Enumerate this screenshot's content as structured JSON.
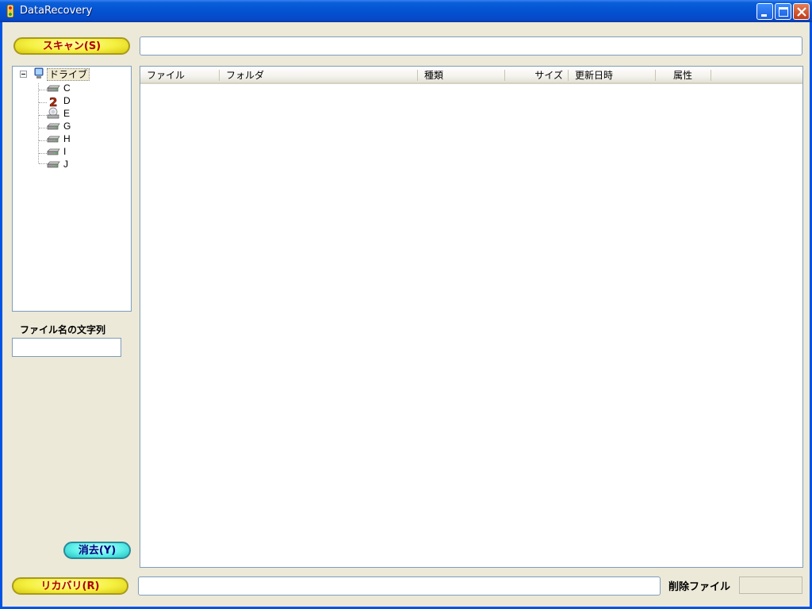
{
  "window": {
    "title": "DataRecovery",
    "accent": "#0054e3",
    "face_color": "#ece9d8"
  },
  "toolbar": {
    "scan_label": "スキャン(S)",
    "scan_path_value": ""
  },
  "tree": {
    "root_label": "ドライブ",
    "root_icon": "computer-icon",
    "drives": [
      {
        "label": "C",
        "icon": "hard-drive-icon"
      },
      {
        "label": "D",
        "icon": "numbered-drive-icon"
      },
      {
        "label": "E",
        "icon": "cd-drive-icon"
      },
      {
        "label": "G",
        "icon": "hard-drive-icon"
      },
      {
        "label": "H",
        "icon": "hard-drive-icon"
      },
      {
        "label": "I",
        "icon": "hard-drive-icon"
      },
      {
        "label": "J",
        "icon": "hard-drive-icon"
      }
    ]
  },
  "filter": {
    "label": "ファイル名の文字列",
    "value": ""
  },
  "clear_button": {
    "label": "消去(Y)"
  },
  "file_list": {
    "columns": [
      "ファイル",
      "フォルダ",
      "種類",
      "サイズ",
      "更新日時",
      "属性"
    ],
    "rows": []
  },
  "footer": {
    "recover_label": "リカバリ(R)",
    "output_path_value": "",
    "deleted_files_label": "削除ファイル",
    "deleted_files_count": ""
  }
}
